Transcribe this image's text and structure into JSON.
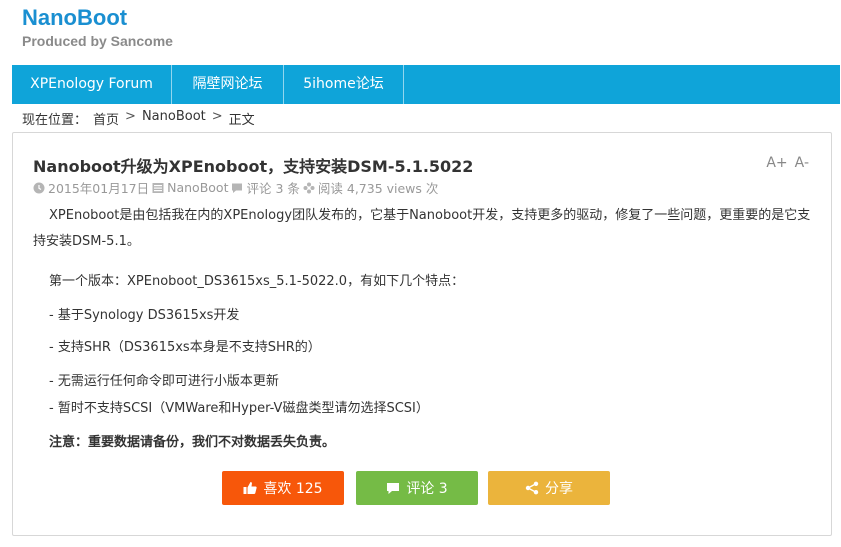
{
  "brand": {
    "title": "NanoBoot",
    "subtitle": "Produced by Sancome",
    "color": "#1a8fd1"
  },
  "nav": {
    "items": [
      {
        "label": "XPEnology Forum"
      },
      {
        "label": "隔壁网论坛"
      },
      {
        "label": "5ihome论坛"
      }
    ],
    "color": "#0fa4d9"
  },
  "breadcrumb": {
    "prefix": "现在位置：",
    "items": [
      "首页",
      "NanoBoot",
      "正文"
    ],
    "sep": ">"
  },
  "post": {
    "title": "Nanoboot升级为XPEnoboot，支持安装DSM-5.1.5022",
    "font_inc": "A+",
    "font_dec": "A-",
    "meta": {
      "date": "2015年01月17日",
      "category": "NanoBoot",
      "comments": "评论 3 条",
      "views": "阅读 4,735 views 次"
    },
    "paragraphs": {
      "intro": "XPEnoboot是由包括我在内的XPEnology团队发布的，它基于Nanoboot开发，支持更多的驱动，修复了一些问题，更重要的是它支持安装DSM-5.1。",
      "version": "第一个版本：XPEnoboot_DS3615xs_5.1-5022.0，有如下几个特点：",
      "feature1": "- 基于Synology DS3615xs开发",
      "feature2": "- 支持SHR（DS3615xs本身是不支持SHR的）",
      "feature3": "- 无需运行任何命令即可进行小版本更新",
      "feature4": "- 暂时不支持SCSI（VMWare和Hyper-V磁盘类型请勿选择SCSI）",
      "notice": "注意：重要数据请备份，我们不对数据丢失负责。"
    }
  },
  "actions": {
    "like": {
      "label": "喜欢 125",
      "color": "#f7570a",
      "icon": "thumbs-up-icon"
    },
    "comment": {
      "label": "评论 3",
      "color": "#75bb46",
      "icon": "comment-icon"
    },
    "share": {
      "label": "分享",
      "color": "#ebb43c",
      "icon": "share-icon"
    }
  }
}
